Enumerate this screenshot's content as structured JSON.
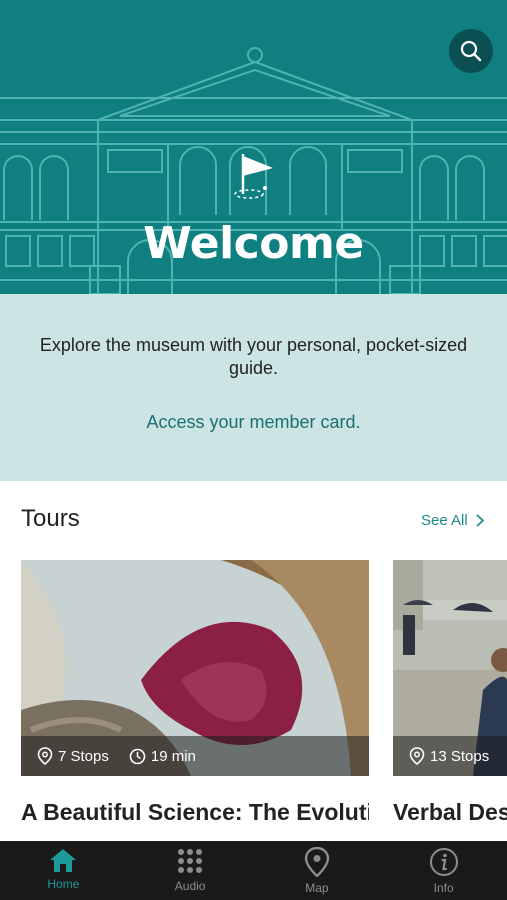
{
  "hero": {
    "title": "Welcome",
    "colors": {
      "background": "#0f7f7f",
      "line": "#4fb3b3",
      "search_bg": "#0b4f52"
    }
  },
  "search": {
    "icon": "search-icon"
  },
  "intro": {
    "text": "Explore the museum with your personal, pocket-sized guide.",
    "member_link": "Access your member card."
  },
  "tours": {
    "heading": "Tours",
    "see_all": "See All",
    "cards": [
      {
        "stops": "7 Stops",
        "duration": "19 min",
        "title": "A Beautiful Science: The Evolution of Chinese Porcelain"
      },
      {
        "stops": "13 Stops",
        "title": "Verbal Descriptions: Essentials"
      }
    ]
  },
  "tabbar": {
    "active_color": "#1d9a9a",
    "tabs": [
      {
        "label": "Home",
        "icon": "home-icon"
      },
      {
        "label": "Audio",
        "icon": "keypad-icon"
      },
      {
        "label": "Map",
        "icon": "map-pin-icon"
      },
      {
        "label": "Info",
        "icon": "info-icon"
      }
    ]
  }
}
